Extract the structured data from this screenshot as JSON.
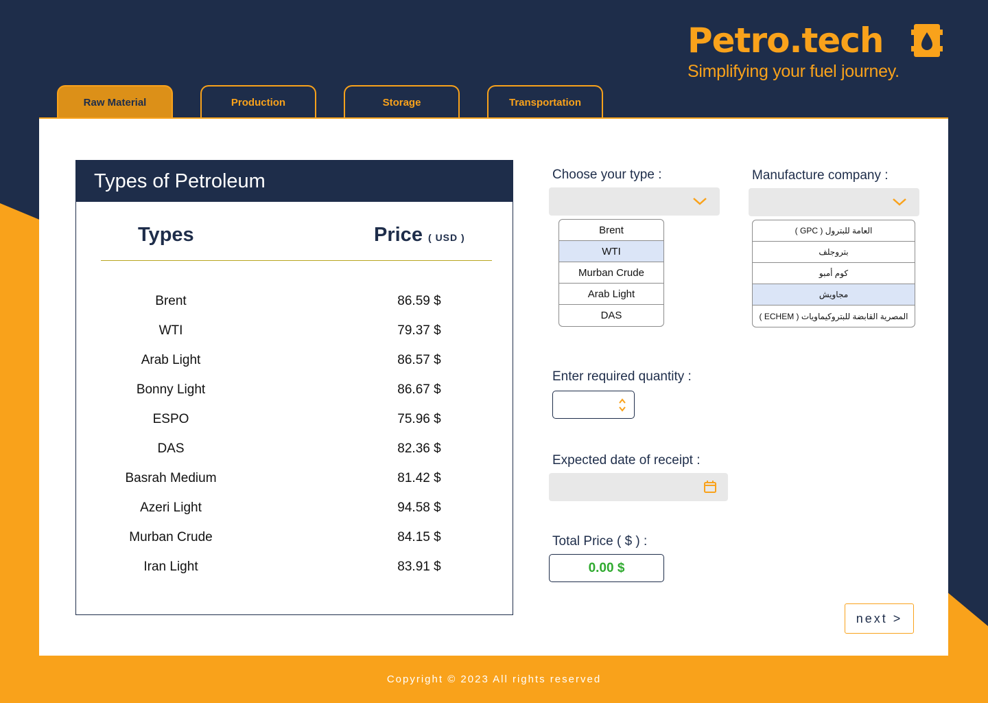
{
  "brand": {
    "title": "Petro.tech",
    "tagline": "Simplifying your fuel journey."
  },
  "tabs": [
    {
      "label": "Raw Material",
      "active": true
    },
    {
      "label": "Production",
      "active": false
    },
    {
      "label": "Storage",
      "active": false
    },
    {
      "label": "Transportation",
      "active": false
    }
  ],
  "types_table": {
    "title": "Types of Petroleum",
    "col_types": "Types",
    "col_price": "Price",
    "col_price_unit": "( USD )",
    "rows": [
      {
        "type": "Brent",
        "price": "86.59 $"
      },
      {
        "type": "WTI",
        "price": "79.37 $"
      },
      {
        "type": "Arab Light",
        "price": "86.57 $"
      },
      {
        "type": "Bonny Light",
        "price": "86.67 $"
      },
      {
        "type": "ESPO",
        "price": "75.96 $"
      },
      {
        "type": "DAS",
        "price": "82.36 $"
      },
      {
        "type": "Basrah Medium",
        "price": "81.42 $"
      },
      {
        "type": "Azeri Light",
        "price": "94.58 $"
      },
      {
        "type": "Murban Crude",
        "price": "84.15 $"
      },
      {
        "type": "Iran Light",
        "price": "83.91 $"
      }
    ]
  },
  "form": {
    "type_label": "Choose your type :",
    "type_options": [
      "Brent",
      "WTI",
      "Murban Crude",
      "Arab Light",
      "DAS"
    ],
    "type_selected_index": 1,
    "company_label": "Manufacture company :",
    "company_options": [
      "العامة للبترول ( GPC )",
      "بتروجلف",
      "كوم أمبو",
      "مجاويش",
      "المصرية القابضة للبتروكيماويات ( ECHEM )"
    ],
    "company_selected_index": 3,
    "quantity_label": "Enter required quantity :",
    "quantity_value": "",
    "date_label": "Expected date of receipt :",
    "date_value": "",
    "total_label": "Total Price ( $ ) :",
    "total_value": "0.00 $",
    "next_label": "next >"
  },
  "footer": {
    "copyright": "Copyright © 2023 All rights reserved"
  },
  "colors": {
    "navy": "#1e2d4a",
    "orange": "#f9a21b",
    "active_tab": "#dc9018",
    "selected_option": "#dbe5f7",
    "total_green": "#2faa2f"
  },
  "icons": [
    "oil-drop-icon",
    "chevron-down-icon",
    "spinner-icon",
    "calendar-icon"
  ]
}
